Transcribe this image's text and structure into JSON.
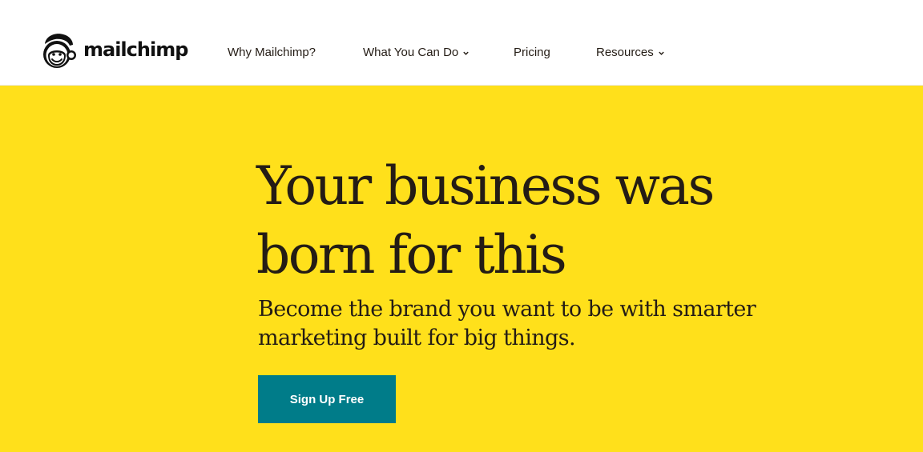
{
  "header": {
    "logo_text": "mailchimp",
    "logo_icon": "freddie-monkey-icon"
  },
  "nav": {
    "items": [
      {
        "label": "Why Mailchimp?",
        "has_dropdown": false
      },
      {
        "label": "What You Can Do",
        "has_dropdown": true
      },
      {
        "label": "Pricing",
        "has_dropdown": false
      },
      {
        "label": "Resources",
        "has_dropdown": true
      }
    ]
  },
  "hero": {
    "headline_line1": "Your business was",
    "headline_line2": "born for this",
    "subhead_line1": "Become the brand you want to be with smarter",
    "subhead_line2": "marketing built for big things.",
    "cta_label": "Sign Up Free"
  },
  "colors": {
    "hero_background": "#ffe01b",
    "cta_background": "#007c89",
    "text_dark": "#241c15"
  }
}
